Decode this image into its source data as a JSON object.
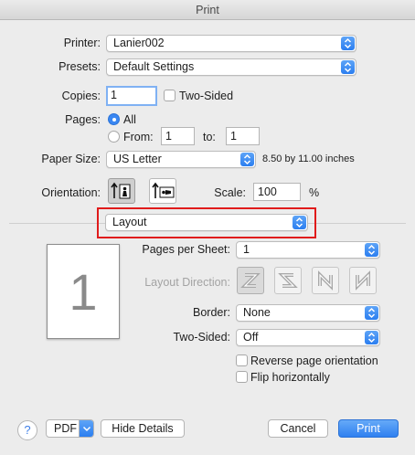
{
  "window": {
    "title": "Print"
  },
  "printer": {
    "label": "Printer:",
    "value": "Lanier002"
  },
  "presets": {
    "label": "Presets:",
    "value": "Default Settings"
  },
  "copies": {
    "label": "Copies:",
    "value": "1",
    "two_sided_label": "Two-Sided"
  },
  "pages": {
    "label": "Pages:",
    "all_label": "All",
    "from_label": "From:",
    "from_value": "1",
    "to_label": "to:",
    "to_value": "1"
  },
  "paper_size": {
    "label": "Paper Size:",
    "value": "US Letter",
    "dimensions": "8.50 by 11.00 inches"
  },
  "orientation": {
    "label": "Orientation:",
    "selected": "portrait"
  },
  "scale": {
    "label": "Scale:",
    "value": "100",
    "unit": "%"
  },
  "section_popup": {
    "value": "Layout"
  },
  "preview": {
    "page_number": "1"
  },
  "layout": {
    "pages_per_sheet_label": "Pages per Sheet:",
    "pages_per_sheet_value": "1",
    "layout_direction_label": "Layout Direction:",
    "border_label": "Border:",
    "border_value": "None",
    "two_sided_label": "Two-Sided:",
    "two_sided_value": "Off",
    "reverse_label": "Reverse page orientation",
    "flip_label": "Flip horizontally"
  },
  "footer": {
    "help_label": "?",
    "pdf_label": "PDF",
    "hide_details_label": "Hide Details",
    "cancel_label": "Cancel",
    "print_label": "Print"
  },
  "colors": {
    "accent": "#2f80f0",
    "highlight": "#e01b1b",
    "background": "#ececec"
  },
  "icons": {
    "popup": "up-down-arrows-icon",
    "portrait": "portrait-orientation-icon",
    "landscape": "landscape-orientation-icon",
    "layout_directions": [
      "z-direction-icon",
      "reverse-z-direction-icon",
      "n-direction-icon",
      "reverse-n-direction-icon"
    ]
  }
}
